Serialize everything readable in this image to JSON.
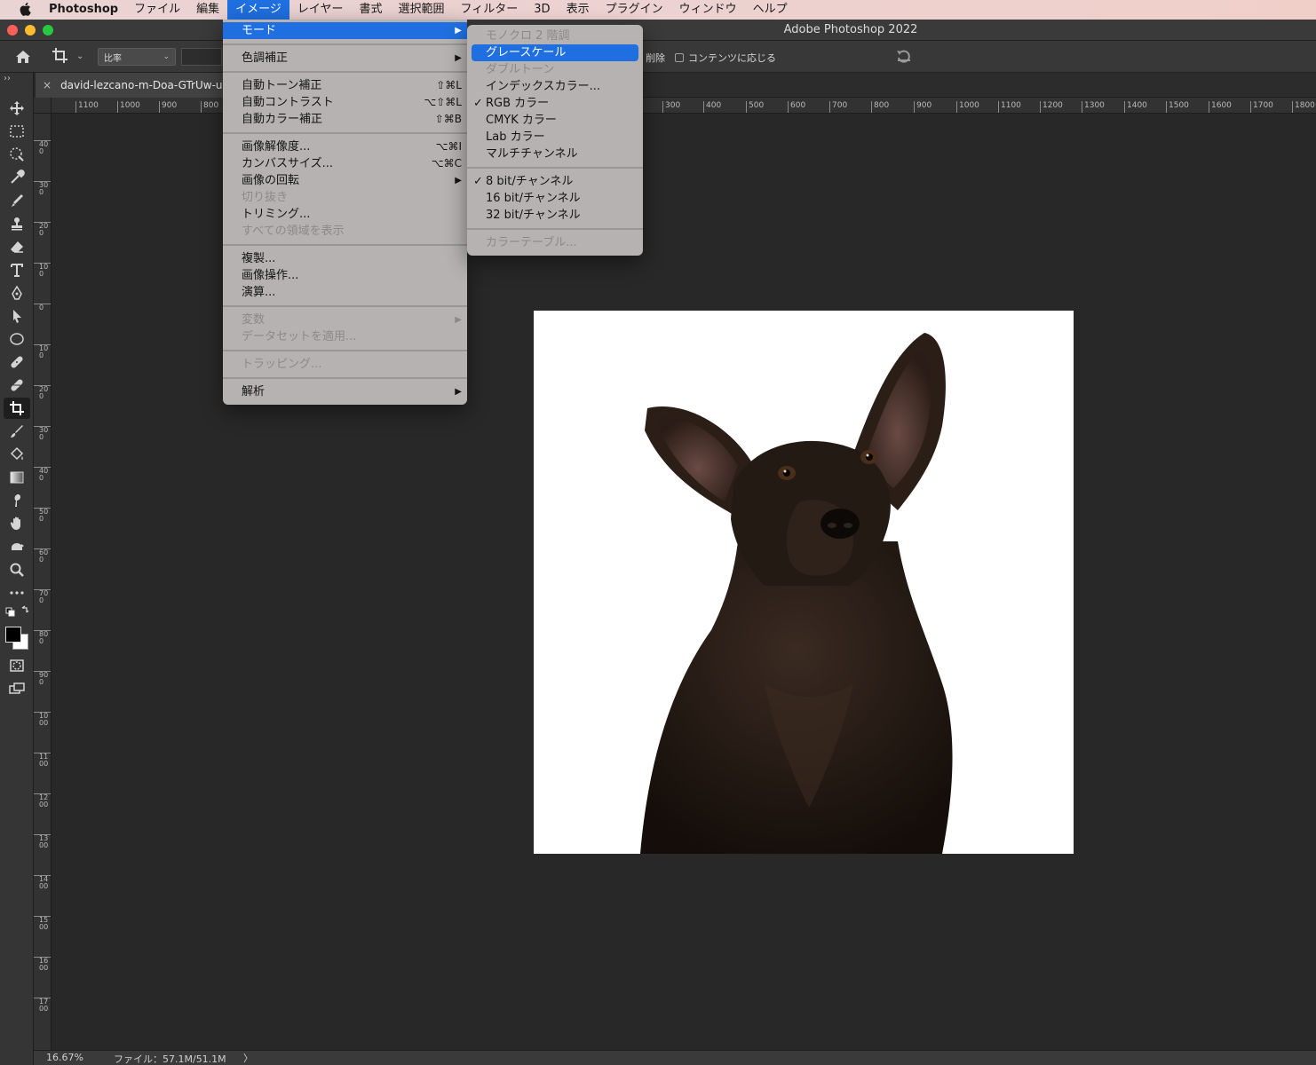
{
  "menubar": {
    "app": "Photoshop",
    "items": [
      "ファイル",
      "編集",
      "イメージ",
      "レイヤー",
      "書式",
      "選択範囲",
      "フィルター",
      "3D",
      "表示",
      "プラグイン",
      "ウィンドウ",
      "ヘルプ"
    ],
    "active_index": 2
  },
  "window": {
    "title": "Adobe Photoshop 2022"
  },
  "optionsbar": {
    "ratio_label": "比率",
    "delete_label": "削除",
    "content_aware_label": "コンテンツに応じる"
  },
  "document": {
    "tab_title": "david-lezcano-m-Doa-GTrUw-u"
  },
  "ruler": {
    "h_labels": [
      "1100",
      "1000",
      "900",
      "800",
      "300",
      "400",
      "500",
      "600",
      "700",
      "800",
      "900",
      "1000",
      "1100",
      "1200",
      "1300",
      "1400",
      "1500",
      "1600",
      "1700",
      "1800"
    ],
    "v_labels": [
      "400",
      "300",
      "200",
      "100",
      "0",
      "100",
      "200",
      "300",
      "400",
      "500",
      "600",
      "700",
      "800",
      "900",
      "1000",
      "1100",
      "1200",
      "1300",
      "1400",
      "1500",
      "1600",
      "1700"
    ]
  },
  "image_menu": {
    "groups": [
      [
        {
          "label": "モード",
          "submenu": true,
          "highlighted": true
        }
      ],
      [
        {
          "label": "色調補正",
          "submenu": true
        }
      ],
      [
        {
          "label": "自動トーン補正",
          "shortcut": "⇧⌘L"
        },
        {
          "label": "自動コントラスト",
          "shortcut": "⌥⇧⌘L"
        },
        {
          "label": "自動カラー補正",
          "shortcut": "⇧⌘B"
        }
      ],
      [
        {
          "label": "画像解像度...",
          "shortcut": "⌥⌘I"
        },
        {
          "label": "カンバスサイズ...",
          "shortcut": "⌥⌘C"
        },
        {
          "label": "画像の回転",
          "submenu": true
        },
        {
          "label": "切り抜き",
          "disabled": true
        },
        {
          "label": "トリミング..."
        },
        {
          "label": "すべての領域を表示",
          "disabled": true
        }
      ],
      [
        {
          "label": "複製..."
        },
        {
          "label": "画像操作..."
        },
        {
          "label": "演算..."
        }
      ],
      [
        {
          "label": "変数",
          "submenu": true,
          "disabled": true
        },
        {
          "label": "データセットを適用...",
          "disabled": true
        }
      ],
      [
        {
          "label": "トラッピング...",
          "disabled": true
        }
      ],
      [
        {
          "label": "解析",
          "submenu": true
        }
      ]
    ]
  },
  "mode_submenu": {
    "groups": [
      [
        {
          "label": "モノクロ 2 階調",
          "disabled": true
        },
        {
          "label": "グレースケール",
          "highlighted": true
        },
        {
          "label": "ダブルトーン",
          "disabled": true
        },
        {
          "label": "インデックスカラー..."
        },
        {
          "label": "RGB カラー",
          "checked": true
        },
        {
          "label": "CMYK カラー"
        },
        {
          "label": "Lab カラー"
        },
        {
          "label": "マルチチャンネル"
        }
      ],
      [
        {
          "label": "8 bit/チャンネル",
          "checked": true
        },
        {
          "label": "16 bit/チャンネル"
        },
        {
          "label": "32 bit/チャンネル"
        }
      ],
      [
        {
          "label": "カラーテーブル...",
          "disabled": true
        }
      ]
    ]
  },
  "status": {
    "zoom": "16.67%",
    "file": "ファイル：57.1M/51.1M",
    "arrow": "〉"
  },
  "glyphs": {
    "submenu_arrow": "▶",
    "check": "✓",
    "close_tab": "×",
    "toolbar_collapse": "››",
    "dropdown": "⌄"
  },
  "colors": {
    "highlight": "#1f6fe0",
    "menu_bg": "#bab7b6",
    "canvas": "#282828",
    "panel": "#353535"
  }
}
